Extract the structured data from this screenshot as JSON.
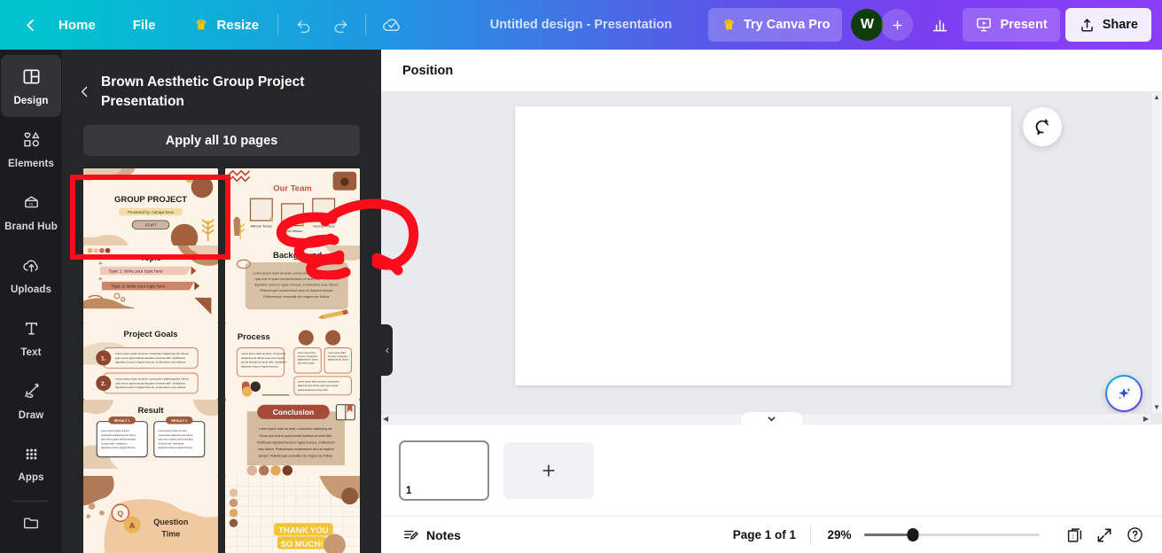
{
  "topbar": {
    "back_icon": "chevron-left-icon",
    "home_label": "Home",
    "file_label": "File",
    "resize_label": "Resize",
    "resize_crown_icon": "crown-icon",
    "undo_icon": "undo-icon",
    "redo_icon": "redo-icon",
    "cloud_icon": "cloud-saved-icon",
    "design_title": "Untitled design - Presentation",
    "try_pro_label": "Try Canva Pro",
    "try_pro_crown_icon": "crown-icon",
    "avatar_initial": "W",
    "avatar_color": "#0d3d0d",
    "add_collaborator_icon": "plus-icon",
    "insights_icon": "bar-chart-icon",
    "present_label": "Present",
    "present_icon": "presentation-screen-icon",
    "share_label": "Share",
    "share_icon": "share-upload-icon",
    "gradient_from": "#00c4cc",
    "gradient_mid": "#3b7be4",
    "gradient_to": "#8b3dfa"
  },
  "rail": {
    "items": [
      {
        "label": "Design",
        "icon": "layout-design-icon",
        "active": true
      },
      {
        "label": "Elements",
        "icon": "shapes-elements-icon",
        "active": false
      },
      {
        "label": "Brand Hub",
        "icon": "brand-hub-icon",
        "active": false
      },
      {
        "label": "Uploads",
        "icon": "cloud-upload-icon",
        "active": false
      },
      {
        "label": "Text",
        "icon": "text-t-icon",
        "active": false
      },
      {
        "label": "Draw",
        "icon": "draw-pen-icon",
        "active": false
      },
      {
        "label": "Apps",
        "icon": "apps-grid-icon",
        "active": false
      }
    ],
    "folder_icon": "folder-icon"
  },
  "panel": {
    "back_icon": "chevron-left-icon",
    "title": "Brown Aesthetic Group Project Presentation",
    "apply_label": "Apply all 10 pages",
    "collapse_icon": "chevron-left-icon",
    "thumbnails": [
      {
        "name": "group-project-cover",
        "title": "GROUP PROJECT",
        "subtitle": "Presented by: Cahaya Dewi",
        "button": "START",
        "selected": true
      },
      {
        "name": "our-team",
        "title": "Our Team",
        "members": [
          "Alfredo Torres",
          "Olivia Wilson",
          "Yeness Torres"
        ],
        "selected": false
      },
      {
        "name": "topic",
        "title": "Topic",
        "lines": [
          "Topic 1: Write your topic here",
          "Topic 2: Write your topic here"
        ],
        "selected": false
      },
      {
        "name": "background",
        "title": "Background",
        "body": "Lorem ipsum dolor sit amet, consectetur adipiscing elit. Donec quis erat et quam lacinia faucibus sit amet nibh.",
        "selected": false
      },
      {
        "name": "project-goals",
        "title": "Project Goals",
        "items": [
          "1.",
          "2."
        ],
        "selected": false
      },
      {
        "name": "process",
        "title": "Process",
        "selected": false
      },
      {
        "name": "result",
        "title": "Result",
        "labels": [
          "RESULT 1",
          "RESULT 2"
        ],
        "selected": false
      },
      {
        "name": "conclusion",
        "title": "Conclusion",
        "selected": false
      },
      {
        "name": "question-time",
        "title": "Question Time",
        "selected": false
      },
      {
        "name": "thank-you",
        "title": "THANK YOU SO MUCH!",
        "selected": false
      }
    ]
  },
  "toolbar": {
    "position_label": "Position"
  },
  "canvas": {
    "comment_icon": "add-comment-icon",
    "magic_icon": "magic-sparkle-icon",
    "scroll_up_icon": "triangle-up-icon",
    "scroll_down_icon": "triangle-down-icon",
    "scroll_left_icon": "triangle-left-icon",
    "scroll_right_icon": "triangle-right-icon"
  },
  "pages": {
    "collapse_icon": "chevron-down-icon",
    "page_number": "1",
    "add_page_icon": "plus-icon"
  },
  "bottombar": {
    "notes_label": "Notes",
    "notes_icon": "notes-icon",
    "page_indicator": "Page 1 of 1",
    "zoom_level": "29%",
    "zoom_slider_value": 28,
    "page_view_icon": "page-view-icon",
    "page_view_badge": "1",
    "fullscreen_icon": "expand-arrows-icon",
    "help_icon": "help-question-icon"
  },
  "annotation": {
    "highlight_box_color": "#fc0d1b",
    "cursor_icon": "hand-pointer-annotation"
  }
}
